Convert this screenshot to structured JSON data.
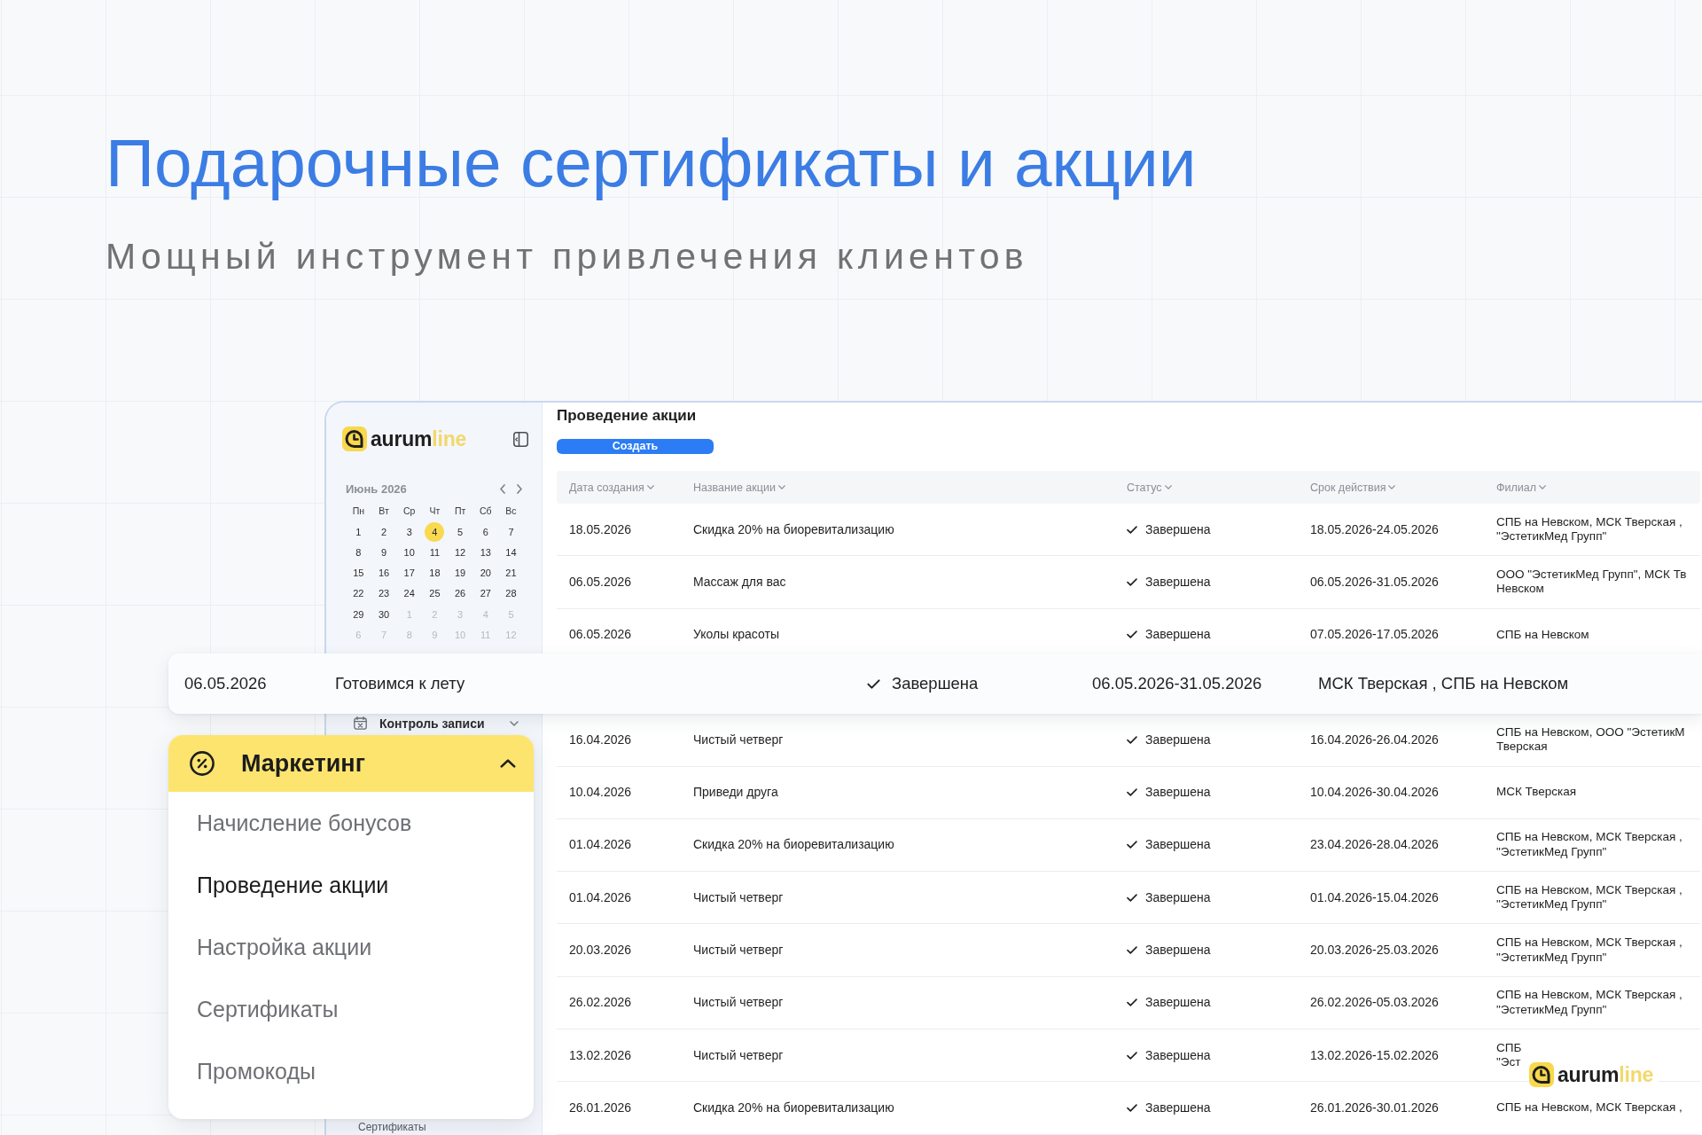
{
  "hero": {
    "title": "Подарочные сертификаты и акции",
    "subtitle": "Мощный инструмент привлечения клиентов"
  },
  "sidebar": {
    "logo": {
      "name": "aurum",
      "accent": "line"
    },
    "calendar": {
      "month": "Июнь 2026",
      "weekdays": [
        "Пн",
        "Вт",
        "Ср",
        "Чт",
        "Пт",
        "Сб",
        "Вс"
      ],
      "days": [
        {
          "label": "1",
          "outside": false,
          "selected": false
        },
        {
          "label": "2",
          "outside": false,
          "selected": false
        },
        {
          "label": "3",
          "outside": false,
          "selected": false
        },
        {
          "label": "4",
          "outside": false,
          "selected": true
        },
        {
          "label": "5",
          "outside": false,
          "selected": false
        },
        {
          "label": "6",
          "outside": false,
          "selected": false
        },
        {
          "label": "7",
          "outside": false,
          "selected": false
        },
        {
          "label": "8",
          "outside": false,
          "selected": false
        },
        {
          "label": "9",
          "outside": false,
          "selected": false
        },
        {
          "label": "10",
          "outside": false,
          "selected": false
        },
        {
          "label": "11",
          "outside": false,
          "selected": false
        },
        {
          "label": "12",
          "outside": false,
          "selected": false
        },
        {
          "label": "13",
          "outside": false,
          "selected": false
        },
        {
          "label": "14",
          "outside": false,
          "selected": false
        },
        {
          "label": "15",
          "outside": false,
          "selected": false
        },
        {
          "label": "16",
          "outside": false,
          "selected": false
        },
        {
          "label": "17",
          "outside": false,
          "selected": false
        },
        {
          "label": "18",
          "outside": false,
          "selected": false
        },
        {
          "label": "19",
          "outside": false,
          "selected": false
        },
        {
          "label": "20",
          "outside": false,
          "selected": false
        },
        {
          "label": "21",
          "outside": false,
          "selected": false
        },
        {
          "label": "22",
          "outside": false,
          "selected": false
        },
        {
          "label": "23",
          "outside": false,
          "selected": false
        },
        {
          "label": "24",
          "outside": false,
          "selected": false
        },
        {
          "label": "25",
          "outside": false,
          "selected": false
        },
        {
          "label": "26",
          "outside": false,
          "selected": false
        },
        {
          "label": "27",
          "outside": false,
          "selected": false
        },
        {
          "label": "28",
          "outside": false,
          "selected": false
        },
        {
          "label": "29",
          "outside": false,
          "selected": false
        },
        {
          "label": "30",
          "outside": false,
          "selected": false
        },
        {
          "label": "1",
          "outside": true,
          "selected": false
        },
        {
          "label": "2",
          "outside": true,
          "selected": false
        },
        {
          "label": "3",
          "outside": true,
          "selected": false
        },
        {
          "label": "4",
          "outside": true,
          "selected": false
        },
        {
          "label": "5",
          "outside": true,
          "selected": false
        },
        {
          "label": "6",
          "outside": true,
          "selected": false
        },
        {
          "label": "7",
          "outside": true,
          "selected": false
        },
        {
          "label": "8",
          "outside": true,
          "selected": false
        },
        {
          "label": "9",
          "outside": true,
          "selected": false
        },
        {
          "label": "10",
          "outside": true,
          "selected": false
        },
        {
          "label": "11",
          "outside": true,
          "selected": false
        },
        {
          "label": "12",
          "outside": true,
          "selected": false
        }
      ]
    },
    "items": [
      {
        "label": "Контроль записи",
        "expanded": false
      }
    ],
    "sub_items": [
      "Сертификаты"
    ]
  },
  "main": {
    "title": "Проведение акции",
    "create_button": "Создать",
    "table": {
      "columns": [
        {
          "label": "Дата создания",
          "sortable": true
        },
        {
          "label": "Название акции",
          "sortable": true
        },
        {
          "label": "Статус",
          "sortable": true
        },
        {
          "label": "Срок действия",
          "sortable": true
        },
        {
          "label": "Филиал",
          "sortable": true
        }
      ],
      "rows": [
        {
          "kind": "row",
          "created": "18.05.2026",
          "name": "Скидка 20% на биоревитализацию",
          "status": "Завершена",
          "period": "18.05.2026-24.05.2026",
          "branch": [
            "СПБ на Невском, МСК Тверская ,",
            "\"ЭстетикМед Групп\""
          ]
        },
        {
          "kind": "row",
          "created": "06.05.2026",
          "name": "Массаж для вас",
          "status": "Завершена",
          "period": "06.05.2026-31.05.2026",
          "branch": [
            "ООО \"ЭстетикМед Групп\", МСК Тв",
            "Невском"
          ]
        },
        {
          "kind": "row",
          "created": "06.05.2026",
          "name": "Уколы красоты",
          "status": "Завершена",
          "period": "07.05.2026-17.05.2026",
          "branch": [
            "СПБ на Невском"
          ]
        },
        {
          "kind": "lifted",
          "card": {
            "created": "06.05.2026",
            "name": "Готовимся к лету",
            "status": "Завершена",
            "period": "06.05.2026-31.05.2026",
            "branch": [
              "МСК Тверская , СПБ на Невском"
            ]
          }
        },
        {
          "kind": "row",
          "created": "16.04.2026",
          "name": "Чистый четверг",
          "status": "Завершена",
          "period": "16.04.2026-26.04.2026",
          "branch": [
            "СПБ на Невском, ООО \"ЭстетикМ",
            "Тверская"
          ]
        },
        {
          "kind": "row",
          "created": "10.04.2026",
          "name": "Приведи друга",
          "status": "Завершена",
          "period": "10.04.2026-30.04.2026",
          "branch": [
            "МСК Тверская"
          ]
        },
        {
          "kind": "row",
          "created": "01.04.2026",
          "name": "Скидка 20% на биоревитализацию",
          "status": "Завершена",
          "period": "23.04.2026-28.04.2026",
          "branch": [
            "СПБ на Невском, МСК Тверская ,",
            "\"ЭстетикМед Групп\""
          ]
        },
        {
          "kind": "row",
          "created": "01.04.2026",
          "name": "Чистый четверг",
          "status": "Завершена",
          "period": "01.04.2026-15.04.2026",
          "branch": [
            "СПБ на Невском, МСК Тверская ,",
            "\"ЭстетикМед Групп\""
          ]
        },
        {
          "kind": "row",
          "created": "20.03.2026",
          "name": "Чистый четверг",
          "status": "Завершена",
          "period": "20.03.2026-25.03.2026",
          "branch": [
            "СПБ на Невском, МСК Тверская ,",
            "\"ЭстетикМед Групп\""
          ]
        },
        {
          "kind": "row",
          "created": "26.02.2026",
          "name": "Чистый четверг",
          "status": "Завершена",
          "period": "26.02.2026-05.03.2026",
          "branch": [
            "СПБ на Невском, МСК Тверская ,",
            "\"ЭстетикМед Групп\""
          ]
        },
        {
          "kind": "row",
          "created": "13.02.2026",
          "name": "Чистый четверг",
          "status": "Завершена",
          "period": "13.02.2026-15.02.2026",
          "branch": [
            "СПБ",
            "\"Эст"
          ]
        },
        {
          "kind": "row",
          "created": "26.01.2026",
          "name": "Скидка 20% на биоревитализацию",
          "status": "Завершена",
          "period": "26.01.2026-30.01.2026",
          "branch": [
            "СПБ на Невском, МСК Тверская ,"
          ]
        }
      ]
    }
  },
  "marketing_menu": {
    "title": "Маркетинг",
    "expanded": true,
    "items": [
      {
        "label": "Начисление бонусов",
        "selected": false
      },
      {
        "label": "Проведение акции",
        "selected": true
      },
      {
        "label": "Настройка акции",
        "selected": false
      },
      {
        "label": "Сертификаты",
        "selected": false
      },
      {
        "label": "Промокоды",
        "selected": false
      }
    ]
  },
  "corner_logo": {
    "name": "aurum",
    "accent": "line"
  }
}
